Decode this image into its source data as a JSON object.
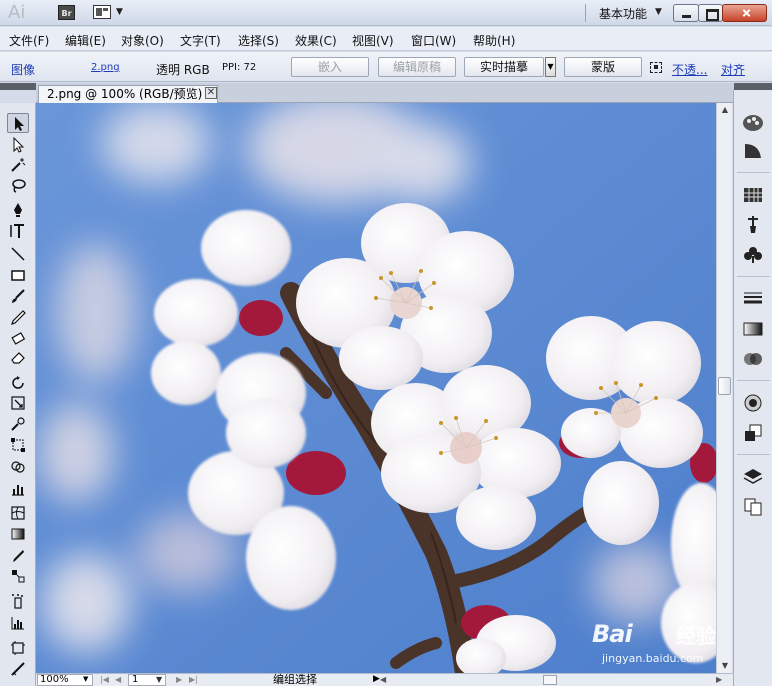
{
  "app": {
    "logo": "Ai",
    "bridge_label": "Br",
    "workspace": "基本功能"
  },
  "menu": [
    "文件(F)",
    "编辑(E)",
    "对象(O)",
    "文字(T)",
    "选择(S)",
    "效果(C)",
    "视图(V)",
    "窗口(W)",
    "帮助(H)"
  ],
  "control_bar": {
    "object_type": "图像",
    "file_name": "2.png",
    "color_mode": "透明 RGB",
    "ppi": "PPI: 72",
    "embed_button": "嵌入",
    "edit_original_button": "编辑原稿",
    "live_trace_button": "实时描摹",
    "mask_button": "蒙版",
    "opacity_link": "不透...",
    "align_link": "对齐"
  },
  "document": {
    "tab_title": "2.png @ 100% (RGB/预览)"
  },
  "status_bar": {
    "zoom": "100%",
    "page": "1",
    "status": "编组选择"
  },
  "watermark": {
    "logo": "Bai",
    "logo_suffix": "经验",
    "url": "jingyan.baidu.com"
  },
  "colors": {
    "sky": "#5d8ad2",
    "petal": "#f4f2f4",
    "calyx": "#a01a3a",
    "branch": "#4a3328"
  }
}
